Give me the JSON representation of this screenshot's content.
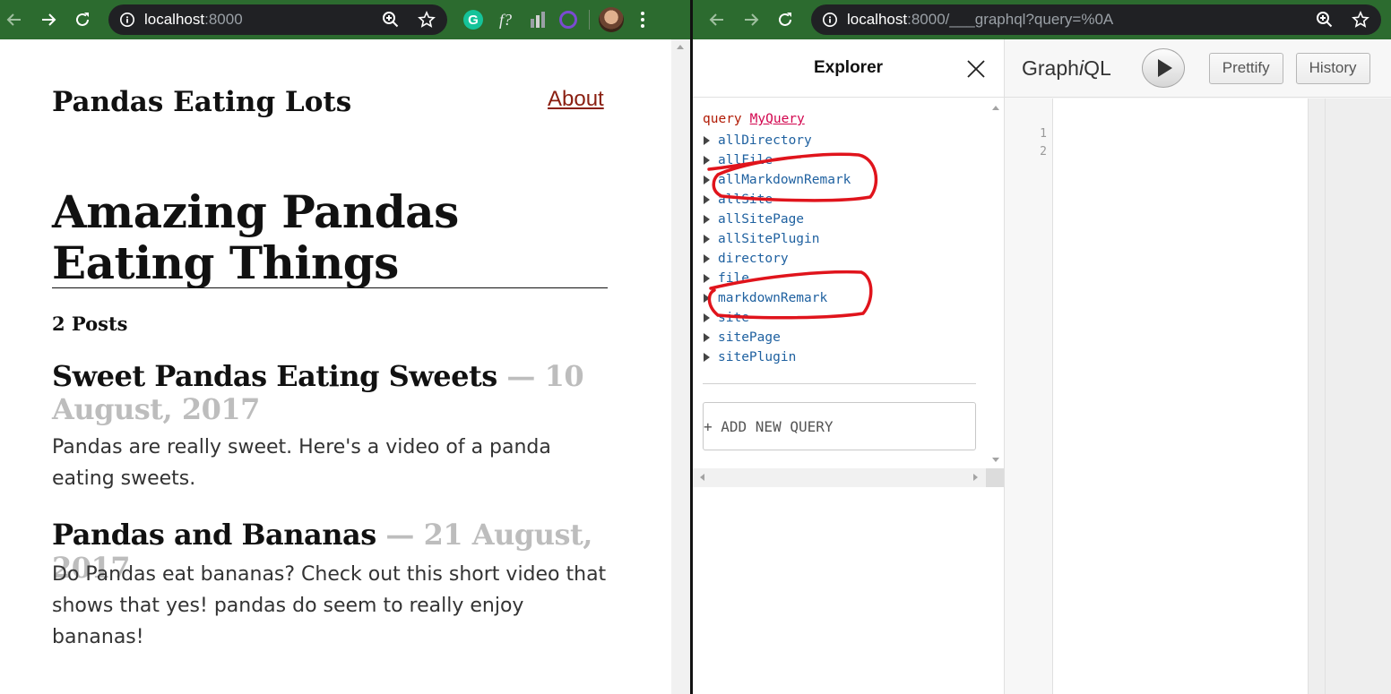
{
  "left_window": {
    "url_host": "localhost",
    "url_rest": ":8000",
    "site_title": "Pandas Eating Lots",
    "about_link": "About",
    "hero_title": "Amazing Pandas Eating Things",
    "posts_count": "2 Posts",
    "posts": [
      {
        "title": "Sweet Pandas Eating Sweets",
        "date": " — 10 August, 2017",
        "excerpt": "Pandas are really sweet. Here's a video of a panda eating sweets."
      },
      {
        "title": "Pandas and Bananas",
        "date": " — 21 August, 2017",
        "excerpt": "Do Pandas eat bananas? Check out this short video that shows that yes! pandas do seem to really enjoy bananas!"
      }
    ]
  },
  "right_window": {
    "url_host": "localhost",
    "url_rest": ":8000/___graphql?query=%0A",
    "explorer": {
      "title": "Explorer",
      "query_keyword": "query",
      "query_name": "MyQuery",
      "fields": [
        "allDirectory",
        "allFile",
        "allMarkdownRemark",
        "allSite",
        "allSitePage",
        "allSitePlugin",
        "directory",
        "file",
        "markdownRemark",
        "site",
        "sitePage",
        "sitePlugin"
      ],
      "add_query": "+ ADD NEW QUERY"
    },
    "graphiql": {
      "logo_pre": "Graph",
      "logo_i": "i",
      "logo_post": "QL",
      "prettify": "Prettify",
      "history": "History",
      "line_numbers": [
        "1",
        "2"
      ]
    }
  },
  "extensions": {
    "grammarly": "G",
    "fx": "f?"
  },
  "colors": {
    "toolbar": "#2c6b2f",
    "link": "#8a1f11",
    "date": "#bdbdbd",
    "field": "#1f61a0",
    "annotation": "#e0141c"
  }
}
